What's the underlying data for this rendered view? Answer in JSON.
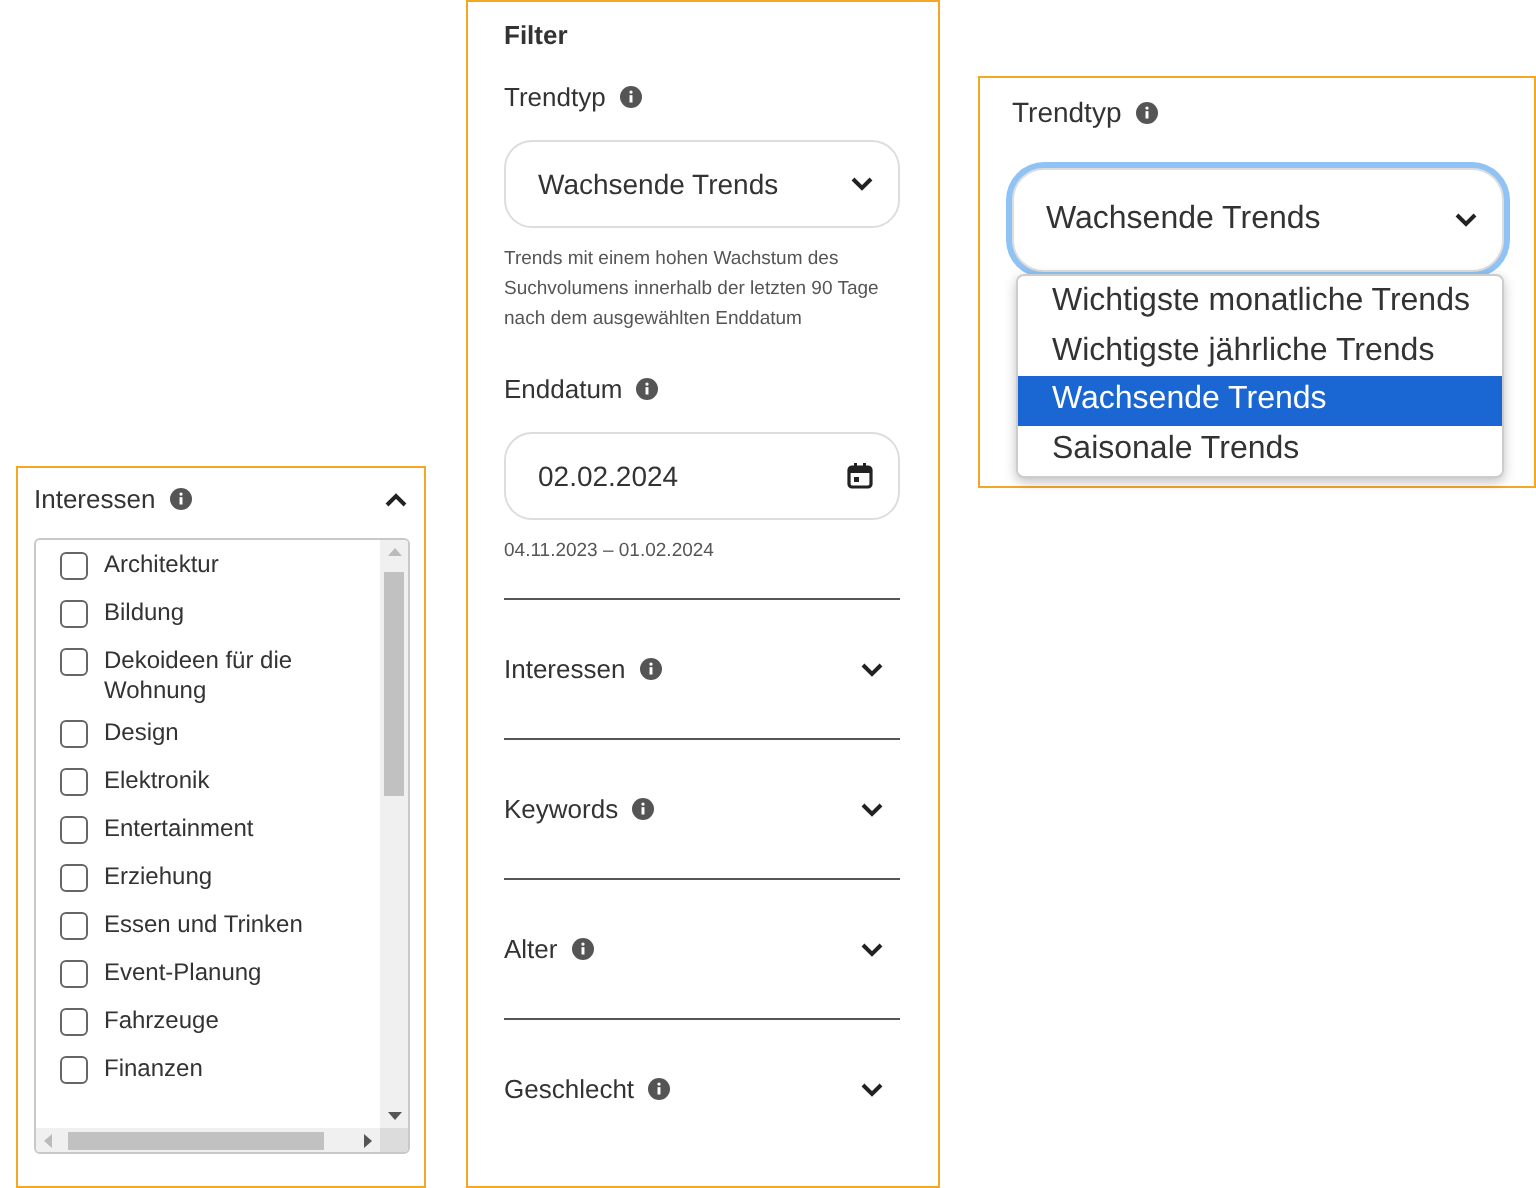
{
  "interest_panel": {
    "title": "Interessen",
    "expanded": true,
    "items": [
      {
        "label": "Architektur",
        "checked": false
      },
      {
        "label": "Bildung",
        "checked": false
      },
      {
        "label": "Dekoideen für die Wohnung",
        "checked": false
      },
      {
        "label": "Design",
        "checked": false
      },
      {
        "label": "Elektronik",
        "checked": false
      },
      {
        "label": "Entertainment",
        "checked": false
      },
      {
        "label": "Erziehung",
        "checked": false
      },
      {
        "label": "Essen und Trinken",
        "checked": false
      },
      {
        "label": "Event-Planung",
        "checked": false
      },
      {
        "label": "Fahrzeuge",
        "checked": false
      },
      {
        "label": "Finanzen",
        "checked": false
      }
    ]
  },
  "filter_panel": {
    "title": "Filter",
    "trend_type": {
      "label": "Trendtyp",
      "value": "Wachsende Trends",
      "help": "Trends mit einem hohen Wachstum des Suchvolumens innerhalb der letzten 90 Tage nach dem ausgewählten Enddatum"
    },
    "end_date": {
      "label": "Enddatum",
      "value": "02.02.2024",
      "range": "04.11.2023 – 01.02.2024"
    },
    "sections": [
      {
        "label": "Interessen",
        "expanded": false
      },
      {
        "label": "Keywords",
        "expanded": false
      },
      {
        "label": "Alter",
        "expanded": false
      },
      {
        "label": "Geschlecht",
        "expanded": false
      }
    ]
  },
  "dropdown_panel": {
    "label": "Trendtyp",
    "value": "Wachsende Trends",
    "focused": true,
    "options": [
      {
        "label": "Wichtigste monatliche Trends",
        "selected": false
      },
      {
        "label": "Wichtigste jährliche Trends",
        "selected": false
      },
      {
        "label": "Wachsende Trends",
        "selected": true
      },
      {
        "label": "Saisonale Trends",
        "selected": false
      }
    ]
  }
}
